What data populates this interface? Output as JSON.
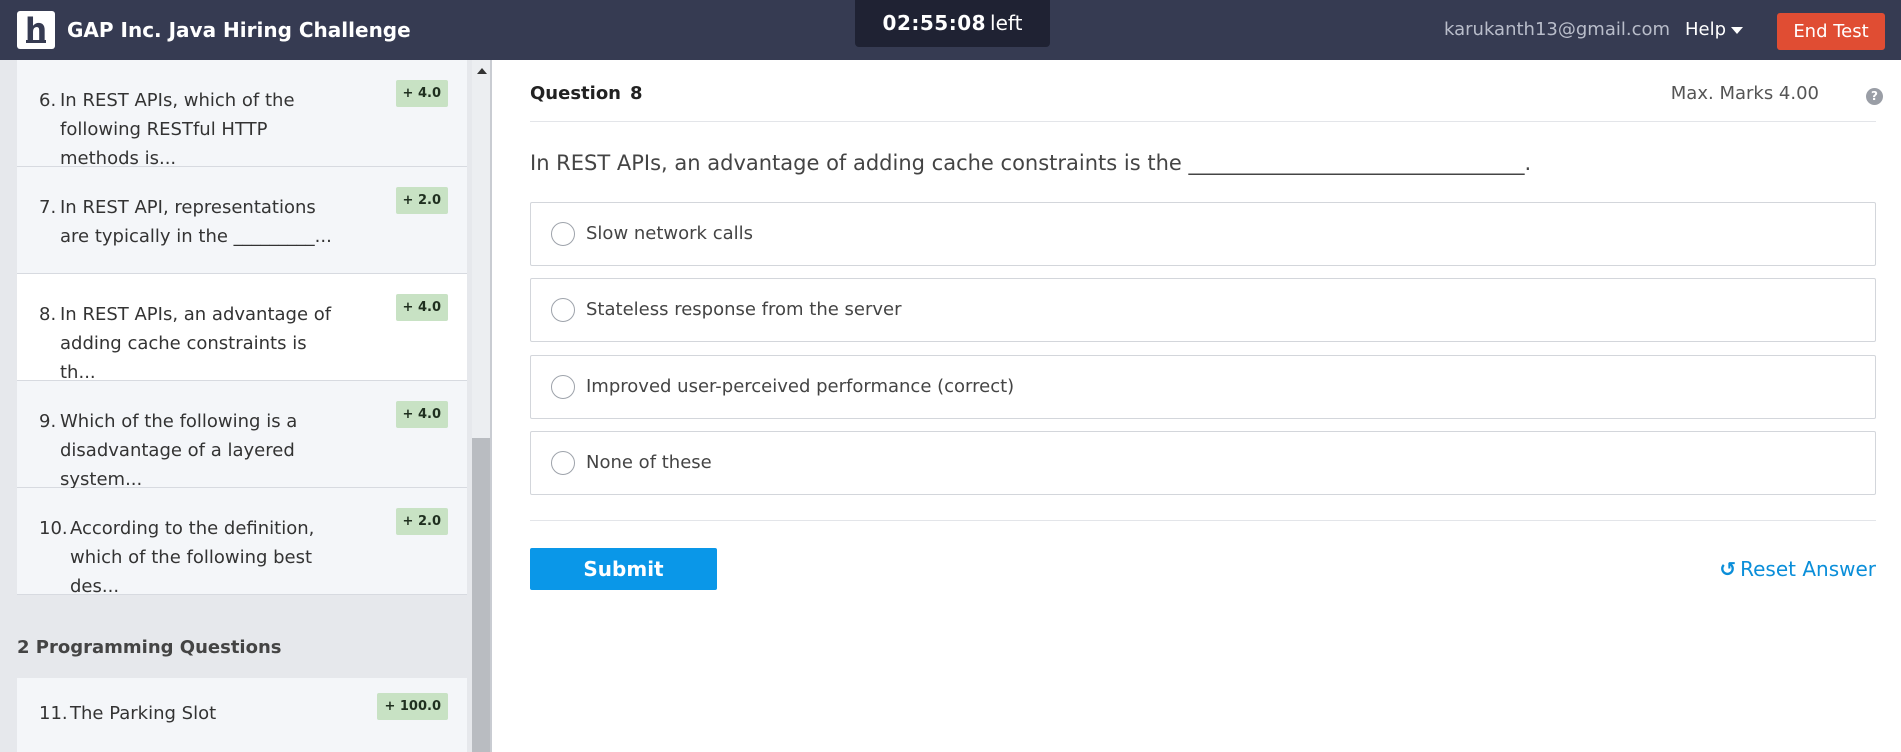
{
  "header": {
    "logo_letter": "h",
    "title": "GAP Inc. Java Hiring Challenge",
    "timer": {
      "time": "02:55:08",
      "suffix": "left"
    },
    "email": "karukanth13@gmail.com",
    "help_label": "Help",
    "end_test_label": "End Test"
  },
  "sidebar": {
    "questions": [
      {
        "num": "6.",
        "text": "In REST APIs, which of the following RESTful HTTP methods is...",
        "marks": "+ 4.0"
      },
      {
        "num": "7.",
        "text": "In REST API, representations are typically in the _________...",
        "marks": "+ 2.0"
      },
      {
        "num": "8.",
        "text": "In REST APIs, an advantage of adding cache constraints is th...",
        "marks": "+ 4.0"
      },
      {
        "num": "9.",
        "text": "Which of the following is a disadvantage of a layered system...",
        "marks": "+ 4.0"
      },
      {
        "num": "10.",
        "text": "According to the definition, which of the following best des...",
        "marks": "+ 2.0"
      }
    ],
    "section_title": "2 Programming Questions",
    "programming_item": {
      "num": "11.",
      "text": "The Parking Slot",
      "marks": "+ 100.0"
    }
  },
  "main": {
    "question_label": "Question",
    "question_number": "8",
    "max_marks": "Max. Marks 4.00",
    "help_icon": "?",
    "question_text": "In REST APIs, an advantage of adding cache constraints is the ________________________________.",
    "options": [
      "Slow network calls",
      "Stateless response from the server",
      "Improved user-perceived performance (correct)",
      "None of these"
    ],
    "submit_label": "Submit",
    "reset_icon": "↺",
    "reset_label": "Reset Answer"
  }
}
